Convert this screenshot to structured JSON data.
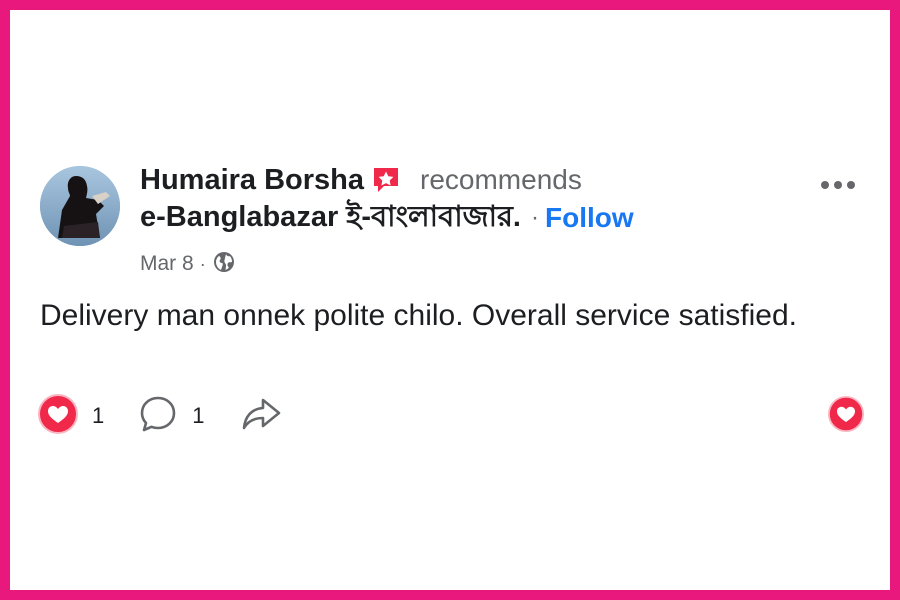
{
  "post": {
    "author": "Humaira Borsha",
    "verb": "recommends",
    "page_name": "e-Banglabazar ই-বাংলাবাজার.",
    "separator": "·",
    "follow_label": "Follow",
    "date": "Mar 8",
    "meta_separator": "·",
    "audience_icon": "globe-icon",
    "text": "Delivery man onnek polite chilo. Overall service satisfied."
  },
  "actions": {
    "reactions_count": "1",
    "comments_count": "1",
    "reaction_icon": "love-reaction-icon",
    "comment_icon": "comment-icon",
    "share_icon": "share-icon"
  },
  "colors": {
    "frame_border": "#e8187c",
    "link_blue": "#1877f2",
    "love_red": "#f02849",
    "secondary_text": "#65676b"
  }
}
